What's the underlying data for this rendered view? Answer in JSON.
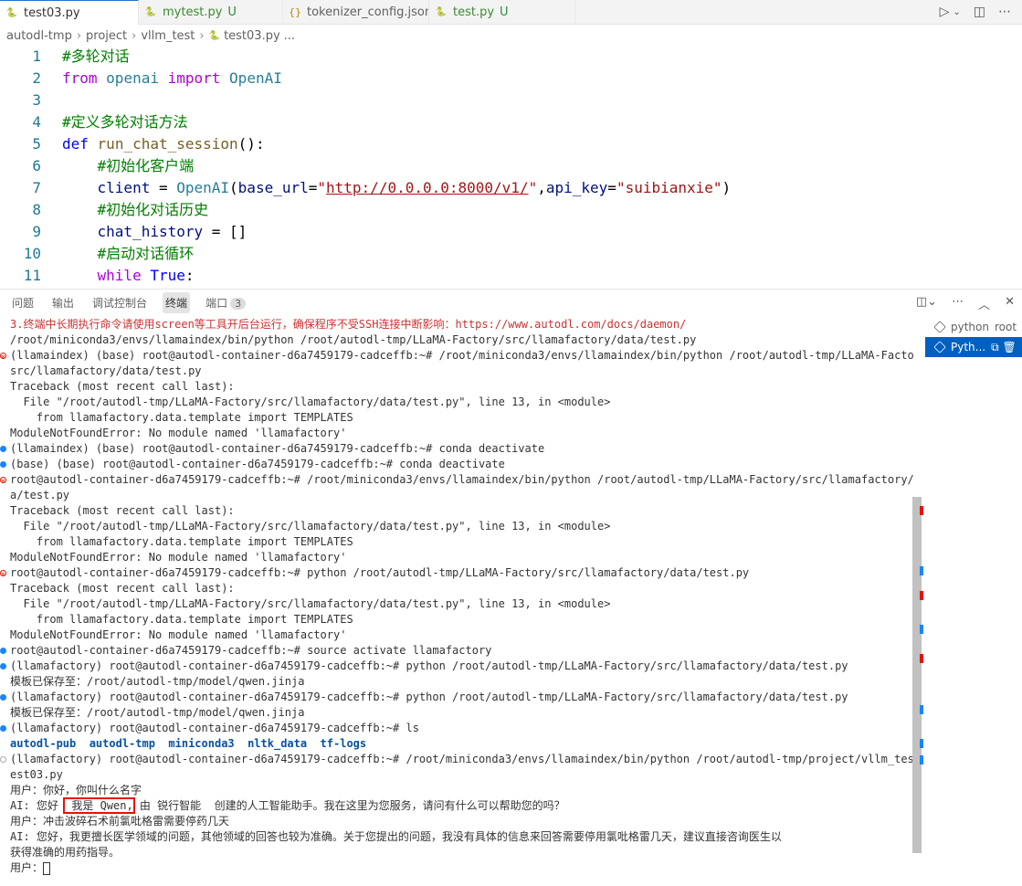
{
  "tabs": [
    {
      "name": "test03.py",
      "icon": "python-icon",
      "active": true,
      "mod": ""
    },
    {
      "name": "mytest.py",
      "icon": "python-icon",
      "active": false,
      "mod": "U"
    },
    {
      "name": "tokenizer_config.json",
      "icon": "json-icon",
      "active": false,
      "mod": ""
    },
    {
      "name": "test.py",
      "icon": "python-icon",
      "active": false,
      "mod": "U"
    }
  ],
  "breadcrumb": [
    "autodl-tmp",
    "project",
    "vllm_test",
    "test03.py",
    "..."
  ],
  "editor": {
    "lines": [
      {
        "n": "1",
        "tokens": [
          [
            "cm",
            "#多轮对话"
          ]
        ]
      },
      {
        "n": "2",
        "tokens": [
          [
            "kw2",
            "from"
          ],
          [
            "plain",
            " "
          ],
          [
            "cls",
            "openai"
          ],
          [
            "plain",
            " "
          ],
          [
            "kw2",
            "import"
          ],
          [
            "plain",
            " "
          ],
          [
            "cls",
            "OpenAI"
          ]
        ]
      },
      {
        "n": "3",
        "tokens": []
      },
      {
        "n": "4",
        "tokens": [
          [
            "cm",
            "#定义多轮对话方法"
          ]
        ]
      },
      {
        "n": "5",
        "tokens": [
          [
            "kw",
            "def"
          ],
          [
            "plain",
            " "
          ],
          [
            "fn",
            "run_chat_session"
          ],
          [
            "plain",
            "():"
          ]
        ]
      },
      {
        "n": "6",
        "tokens": [
          [
            "plain",
            "    "
          ],
          [
            "cm",
            "#初始化客户端"
          ]
        ]
      },
      {
        "n": "7",
        "tokens": [
          [
            "plain",
            "    "
          ],
          [
            "var",
            "client"
          ],
          [
            "plain",
            " = "
          ],
          [
            "cls",
            "OpenAI"
          ],
          [
            "plain",
            "("
          ],
          [
            "var",
            "base_url"
          ],
          [
            "plain",
            "="
          ],
          [
            "str",
            "\""
          ],
          [
            "url",
            "http://0.0.0.0:8000/v1/"
          ],
          [
            "str",
            "\""
          ],
          [
            "plain",
            ","
          ],
          [
            "var",
            "api_key"
          ],
          [
            "plain",
            "="
          ],
          [
            "str",
            "\"suibianxie\""
          ],
          [
            "plain",
            ")"
          ]
        ]
      },
      {
        "n": "8",
        "tokens": [
          [
            "plain",
            "    "
          ],
          [
            "cm",
            "#初始化对话历史"
          ]
        ]
      },
      {
        "n": "9",
        "tokens": [
          [
            "plain",
            "    "
          ],
          [
            "var",
            "chat_history"
          ],
          [
            "plain",
            " = []"
          ]
        ]
      },
      {
        "n": "10",
        "tokens": [
          [
            "plain",
            "    "
          ],
          [
            "cm",
            "#启动对话循环"
          ]
        ]
      },
      {
        "n": "11",
        "tokens": [
          [
            "plain",
            "    "
          ],
          [
            "kw2",
            "while"
          ],
          [
            "plain",
            " "
          ],
          [
            "kw",
            "True"
          ],
          [
            "plain",
            ":"
          ]
        ]
      }
    ]
  },
  "panel": {
    "tabs": [
      "问题",
      "输出",
      "调试控制台",
      "终端",
      "端口"
    ],
    "active_tab": "终端",
    "ports_badge": "3"
  },
  "terminal_lines": [
    {
      "dot": "",
      "text": "3.终端中长期执行命令请使用screen等工具开后台运行，确保程序不受SSH连接中断影响：https://www.autodl.com/docs/daemon/",
      "style": "red"
    },
    {
      "dot": "",
      "text": "/root/miniconda3/envs/llamaindex/bin/python /root/autodl-tmp/LLaMA-Factory/src/llamafactory/data/test.py"
    },
    {
      "dot": "err",
      "text": "(llamaindex) (base) root@autodl-container-d6a7459179-cadceffb:~# /root/miniconda3/envs/llamaindex/bin/python /root/autodl-tmp/LLaMA-Factory/"
    },
    {
      "dot": "",
      "text": "src/llamafactory/data/test.py"
    },
    {
      "dot": "",
      "text": "Traceback (most recent call last):"
    },
    {
      "dot": "",
      "text": "  File \"/root/autodl-tmp/LLaMA-Factory/src/llamafactory/data/test.py\", line 13, in <module>"
    },
    {
      "dot": "",
      "text": "    from llamafactory.data.template import TEMPLATES"
    },
    {
      "dot": "",
      "text": "ModuleNotFoundError: No module named 'llamafactory'"
    },
    {
      "dot": "blue",
      "text": "(llamaindex) (base) root@autodl-container-d6a7459179-cadceffb:~# conda deactivate"
    },
    {
      "dot": "blue",
      "text": "(base) (base) root@autodl-container-d6a7459179-cadceffb:~# conda deactivate"
    },
    {
      "dot": "err",
      "text": "root@autodl-container-d6a7459179-cadceffb:~# /root/miniconda3/envs/llamaindex/bin/python /root/autodl-tmp/LLaMA-Factory/src/llamafactory/dat"
    },
    {
      "dot": "",
      "text": "a/test.py"
    },
    {
      "dot": "",
      "text": "Traceback (most recent call last):"
    },
    {
      "dot": "",
      "text": "  File \"/root/autodl-tmp/LLaMA-Factory/src/llamafactory/data/test.py\", line 13, in <module>",
      "style": "underline"
    },
    {
      "dot": "",
      "text": "    from llamafactory.data.template import TEMPLATES"
    },
    {
      "dot": "",
      "text": "ModuleNotFoundError: No module named 'llamafactory'"
    },
    {
      "dot": "err",
      "text": "root@autodl-container-d6a7459179-cadceffb:~# python /root/autodl-tmp/LLaMA-Factory/src/llamafactory/data/test.py"
    },
    {
      "dot": "",
      "text": "Traceback (most recent call last):"
    },
    {
      "dot": "",
      "text": "  File \"/root/autodl-tmp/LLaMA-Factory/src/llamafactory/data/test.py\", line 13, in <module>"
    },
    {
      "dot": "",
      "text": "    from llamafactory.data.template import TEMPLATES"
    },
    {
      "dot": "",
      "text": "ModuleNotFoundError: No module named 'llamafactory'"
    },
    {
      "dot": "blue",
      "text": "root@autodl-container-d6a7459179-cadceffb:~# source activate llamafactory"
    },
    {
      "dot": "blue",
      "text": "(llamafactory) root@autodl-container-d6a7459179-cadceffb:~# python /root/autodl-tmp/LLaMA-Factory/src/llamafactory/data/test.py"
    },
    {
      "dot": "",
      "text": "模板已保存至：/root/autodl-tmp/model/qwen.jinja"
    },
    {
      "dot": "blue",
      "text": "(llamafactory) root@autodl-container-d6a7459179-cadceffb:~# python /root/autodl-tmp/LLaMA-Factory/src/llamafactory/data/test.py"
    },
    {
      "dot": "",
      "text": "模板已保存至：/root/autodl-tmp/model/qwen.jinja"
    },
    {
      "dot": "blue",
      "text": "(llamafactory) root@autodl-container-d6a7459179-cadceffb:~# ls"
    },
    {
      "dot": "",
      "text": "autodl-pub  autodl-tmp  miniconda3  nltk_data  tf-logs",
      "style": "boldblue"
    },
    {
      "dot": "hollow",
      "text": "(llamafactory) root@autodl-container-d6a7459179-cadceffb:~# /root/miniconda3/envs/llamaindex/bin/python /root/autodl-tmp/project/vllm_test/t"
    },
    {
      "dot": "",
      "text": "est03.py"
    },
    {
      "dot": "",
      "text": "用户：你好，你叫什么名字"
    },
    {
      "dot": "",
      "text": "AI: 您好  我是 Qwen, 由 锐行智能  创建的人工智能助手。我在这里为您服务，请问有什么可以帮助您的吗？",
      "style": "highlight",
      "hl": " 我是 Qwen,"
    },
    {
      "dot": "",
      "text": "用户：冲击波碎石术前氯吡格雷需要停药几天"
    },
    {
      "dot": "",
      "text": "AI: 您好，我更擅长医学领域的问题，其他领域的回答也较为准确。关于您提出的问题，我没有具体的信息来回答需要停用氯吡格雷几天，建议直接咨询医生以"
    },
    {
      "dot": "",
      "text": "获得准确的用药指导。"
    },
    {
      "dot": "",
      "text": "用户：",
      "style": "cursor"
    }
  ],
  "terminal_list": [
    {
      "label": "python",
      "extra": "root",
      "selected": false
    },
    {
      "label": "Pyth...",
      "extra": "⧉ 🗑",
      "selected": true
    }
  ]
}
